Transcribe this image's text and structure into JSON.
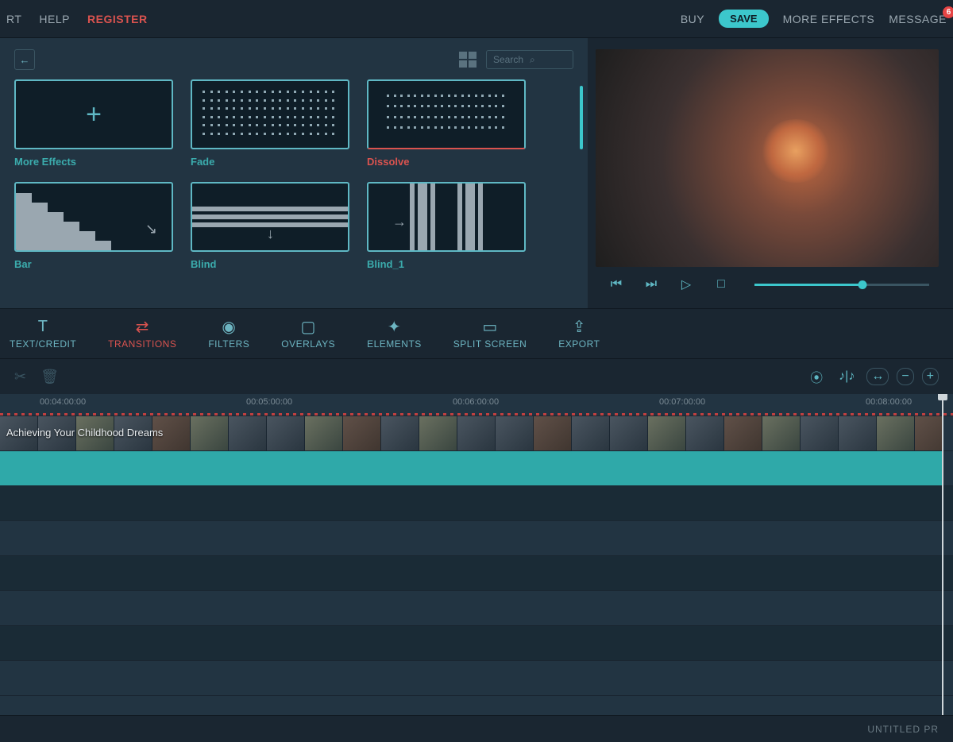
{
  "menu": {
    "item0": "RT",
    "help": "HELP",
    "register": "REGISTER"
  },
  "topright": {
    "buy": "BUY",
    "save": "SAVE",
    "more_effects": "MORE EFFECTS",
    "message": "MESSAGE",
    "badge": "6"
  },
  "search": {
    "placeholder": "Search"
  },
  "transitions": [
    {
      "label": "More Effects",
      "active": false
    },
    {
      "label": "Fade",
      "active": false
    },
    {
      "label": "Dissolve",
      "active": true
    },
    {
      "label": "Bar",
      "active": false
    },
    {
      "label": "Blind",
      "active": false
    },
    {
      "label": "Blind_1",
      "active": false
    }
  ],
  "tabs": {
    "text": "TEXT/CREDIT",
    "transitions": "TRANSITIONS",
    "filters": "FILTERS",
    "overlays": "OVERLAYS",
    "elements": "ELEMENTS",
    "split": "SPLIT SCREEN",
    "export": "EXPORT"
  },
  "ruler": {
    "t0": "00:04:00:00",
    "t1": "00:05:00:00",
    "t2": "00:06:00:00",
    "t3": "00:07:00:00",
    "t4": "00:08:00:00"
  },
  "clip": {
    "title": "Achieving Your Childhood Dreams"
  },
  "footer": {
    "project": "UNTITLED PR"
  },
  "colors": {
    "accent": "#3cc7cc",
    "danger": "#d9534f",
    "bg": "#1a2631"
  }
}
